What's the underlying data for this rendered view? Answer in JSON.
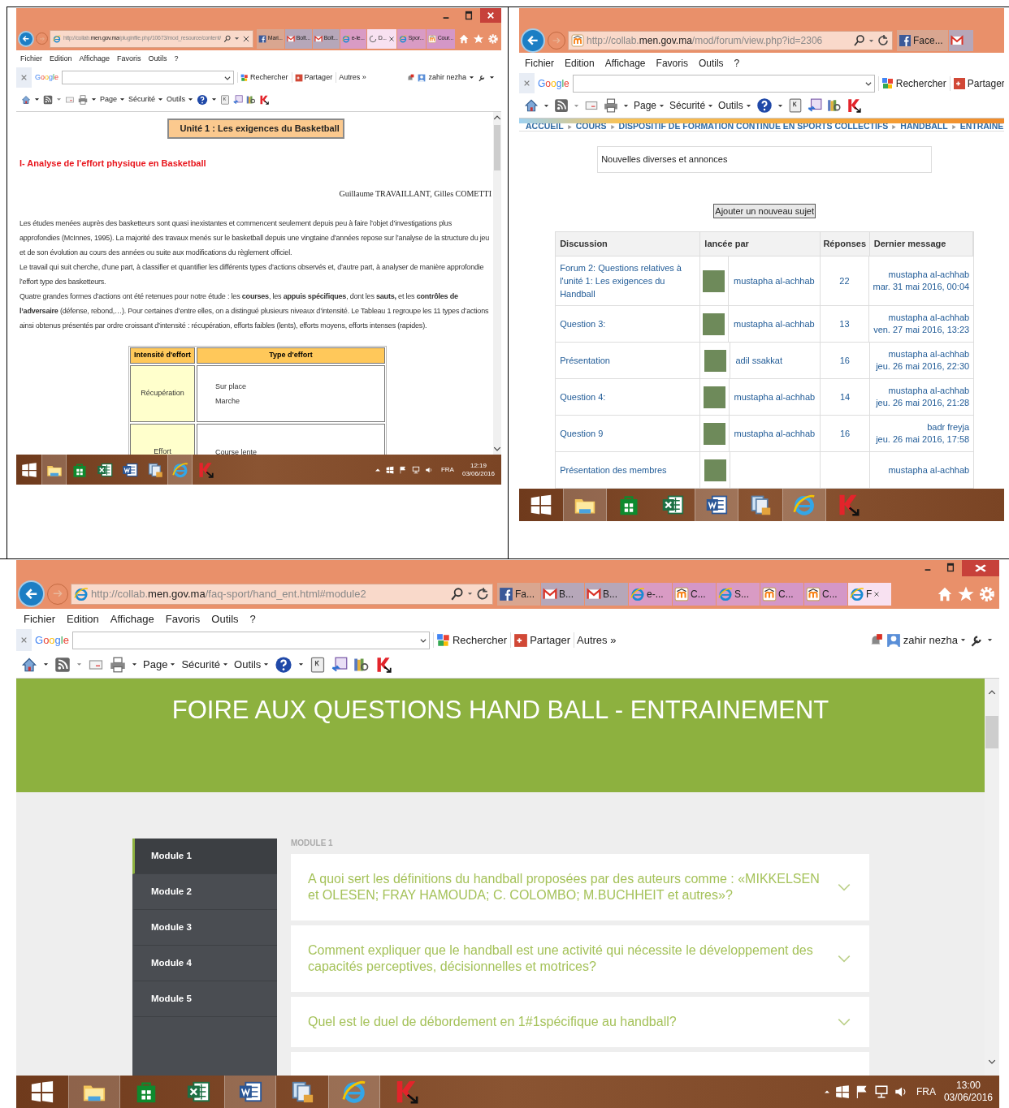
{
  "windows": [
    {
      "window_controls": true,
      "address": {
        "parts": [
          "http://collab.",
          "men.gov.ma",
          "/pluginfile.php/10673/mod_resource/content/"
        ]
      },
      "tabs": [
        {
          "label": "Mari...",
          "kind": "facebook",
          "selected": false
        },
        {
          "label": "Boît...",
          "kind": "mail",
          "selected": false
        },
        {
          "label": "Boît...",
          "kind": "mail",
          "selected": false
        },
        {
          "label": "e-le...",
          "kind": "browser",
          "selected": false
        },
        {
          "label": "D...",
          "kind": "loading",
          "selected": true
        },
        {
          "label": "Spor...",
          "kind": "browser",
          "selected": false
        },
        {
          "label": "Cour...",
          "kind": "course",
          "selected": false
        }
      ],
      "nav_icons": true,
      "menu": [
        "Fichier",
        "Edition",
        "Affichage",
        "Favoris",
        "Outils",
        "?"
      ],
      "google_toolbar": {
        "logo": "Google",
        "buttons": [
          {
            "label": "Rechercher",
            "kind": "search"
          },
          {
            "label": "Partager",
            "kind": "share"
          },
          {
            "label": "Autres »",
            "kind": "plain"
          }
        ],
        "user": "zahir nezha"
      },
      "command_bar": [
        "Page",
        "Sécurité",
        "Outils"
      ],
      "content": {
        "kind": "document",
        "title": "Unité 1 : Les exigences du Basketball",
        "heading": "I- Analyse de l'effort physique en Basketball",
        "authors": "Guillaume TRAVAILLANT, Gilles COMETTI",
        "paragraphs": [
          "Les études menées auprès des basketteurs sont quasi inexistantes et commencent seulement depuis peu à faire l’objet d’investigations plus approfondies (McInnes, 1995). La majorité des travaux menés sur le basketball depuis une vingtaine d’années repose sur l’analyse de la structure du jeu et de son évolution au cours des années ou suite aux modifications du règlement officiel.",
          "Le travail qui suit cherche, d’une part, à classifier et quantifier les différents types d’actions observés et, d’autre part, à analyser de manière approfondie l’effort type des basketteurs.",
          "Quatre grandes formes d’actions ont été retenues pour notre étude : les **courses**, les **appuis spécifiques**, dont les **sauts,** et les **contrôles de l’adversaire** (défense, rebond,…). Pour certaines d’entre elles, on a distingué plusieurs niveaux d’intensité. Le Tableau 1 regroupe les 11 types d’actions ainsi obtenus présentés par ordre croissant d’intensité : récupération, efforts faibles (lents), efforts moyens, efforts intenses (rapides)."
        ],
        "table": {
          "columns": [
            "Intensité d'effort",
            "Type d'effort"
          ],
          "rows": [
            {
              "intensity": "Récupération",
              "types": [
                "Sur place",
                "Marche"
              ]
            },
            {
              "intensity": "Effort",
              "types": [
                "Course lente"
              ]
            }
          ]
        }
      },
      "taskbar": {
        "items": [
          {
            "kind": "start",
            "running": false
          },
          {
            "kind": "explorer",
            "running": true
          },
          {
            "kind": "store",
            "running": false
          },
          {
            "kind": "spreadsheet",
            "running": false
          },
          {
            "kind": "document",
            "running": false
          },
          {
            "kind": "files",
            "running": false
          },
          {
            "kind": "browser",
            "running": true
          },
          {
            "kind": "antivirus",
            "running": false
          }
        ],
        "tray": {
          "language": "FRA",
          "time": "12:19",
          "date": "03/06/2016"
        }
      }
    },
    {
      "window_controls": false,
      "address": {
        "parts": [
          "http://collab.",
          "men.gov.ma",
          "/mod/forum/view.php?id=2306"
        ]
      },
      "tabs": [
        {
          "label": "Face...",
          "kind": "facebook",
          "selected": false
        },
        {
          "kind": "mail",
          "selected": false
        }
      ],
      "nav_icons": false,
      "menu": [
        "Fichier",
        "Edition",
        "Affichage",
        "Favoris",
        "Outils",
        "?"
      ],
      "google_toolbar": {
        "logo": "Google",
        "buttons": [
          {
            "label": "Rechercher",
            "kind": "search"
          },
          {
            "label": "Partager",
            "kind": "share"
          }
        ]
      },
      "command_bar": [
        "Page",
        "Sécurité",
        "Outils"
      ],
      "content": {
        "kind": "forum",
        "breadcrumb": [
          "ACCUEIL",
          "COURS",
          "DISPOSITIF DE FORMATION CONTINUE EN SPORTS COLLECTIFS",
          "HANDBALL",
          "ENTRAINE"
        ],
        "intro": "Nouvelles diverses et annonces",
        "add_button": "Ajouter un nouveau sujet",
        "columns": [
          "Discussion",
          "lancée par",
          "Réponses",
          "Dernier message"
        ],
        "rows": [
          {
            "discussion": "Forum 2: Questions relatives à l'unité 1: Les exigences du Handball",
            "author": "mustapha al-achhab",
            "replies": "22",
            "last_author": "mustapha al-achhab",
            "last_date": "mar. 31 mai 2016, 00:04"
          },
          {
            "discussion": "Question 3:",
            "author": "mustapha al-achhab",
            "replies": "13",
            "last_author": "mustapha al-achhab",
            "last_date": "ven. 27 mai 2016, 13:23"
          },
          {
            "discussion": "Présentation",
            "author": "adil ssakkat",
            "replies": "16",
            "last_author": "mustapha al-achhab",
            "last_date": "jeu. 26 mai 2016, 22:30"
          },
          {
            "discussion": "Question 4:",
            "author": "mustapha al-achhab",
            "replies": "14",
            "last_author": "mustapha al-achhab",
            "last_date": "jeu. 26 mai 2016, 21:28"
          },
          {
            "discussion": "Question 9",
            "author": "mustapha al-achhab",
            "replies": "16",
            "last_author": "badr freyja",
            "last_date": "jeu. 26 mai 2016, 17:58"
          },
          {
            "discussion": "Présentation des membres",
            "last_author": "mustapha al-achhab"
          }
        ]
      },
      "taskbar": {
        "items": [
          {
            "kind": "start",
            "running": false
          },
          {
            "kind": "explorer",
            "running": true
          },
          {
            "kind": "store",
            "running": false
          },
          {
            "kind": "spreadsheet",
            "running": false
          },
          {
            "kind": "document",
            "running": true
          },
          {
            "kind": "files",
            "running": false
          },
          {
            "kind": "browser",
            "running": true
          },
          {
            "kind": "antivirus",
            "running": false
          }
        ]
      }
    },
    {
      "window_controls": true,
      "address": {
        "parts": [
          "http://collab.",
          "men.gov.ma",
          "/faq-sport/hand_ent.html#module2"
        ]
      },
      "tabs": [
        {
          "label": "Fa...",
          "kind": "facebook",
          "selected": false
        },
        {
          "label": "B...",
          "kind": "mail",
          "selected": false
        },
        {
          "label": "B...",
          "kind": "mail",
          "selected": false
        },
        {
          "label": "e-...",
          "kind": "browser",
          "selected": false
        },
        {
          "label": "C...",
          "kind": "course",
          "selected": false
        },
        {
          "label": "S...",
          "kind": "browser",
          "selected": false
        },
        {
          "label": "C...",
          "kind": "course",
          "selected": false
        },
        {
          "label": "C...",
          "kind": "course",
          "selected": false
        },
        {
          "label": "F",
          "kind": "browser",
          "selected": true
        }
      ],
      "nav_icons": true,
      "menu": [
        "Fichier",
        "Edition",
        "Affichage",
        "Favoris",
        "Outils",
        "?"
      ],
      "google_toolbar": {
        "logo": "Google",
        "buttons": [
          {
            "label": "Rechercher",
            "kind": "search"
          },
          {
            "label": "Partager",
            "kind": "share"
          },
          {
            "label": "Autres »",
            "kind": "plain"
          }
        ],
        "user": "zahir nezha"
      },
      "command_bar": [
        "Page",
        "Sécurité",
        "Outils"
      ],
      "content": {
        "kind": "faq",
        "title": "FOIRE AUX QUESTIONS HAND BALL - ENTRAINEMENT",
        "modules": [
          {
            "label": "Module 1",
            "selected": true
          },
          {
            "label": "Module 2",
            "selected": false
          },
          {
            "label": "Module 3",
            "selected": false
          },
          {
            "label": "Module 4",
            "selected": false
          },
          {
            "label": "Module 5",
            "selected": false
          }
        ],
        "section_label": "MODULE 1",
        "questions": [
          "A quoi sert les définitions du handball proposées par des auteurs comme : «MIKKELSEN et OLESEN; FRAY HAMOUDA; C. COLOMBO; M.BUCHHEIT et autres»?",
          "Comment expliquer que le handball est une activité qui nécessite le développement des capacités perceptives, décisionnelles et motrices?",
          "Quel est le duel de débordement en 1#1spécifique au handball?"
        ]
      },
      "taskbar": {
        "items": [
          {
            "kind": "start",
            "running": false
          },
          {
            "kind": "explorer",
            "running": true
          },
          {
            "kind": "store",
            "running": false
          },
          {
            "kind": "spreadsheet",
            "running": false
          },
          {
            "kind": "document",
            "running": true
          },
          {
            "kind": "files",
            "running": false
          },
          {
            "kind": "browser",
            "running": true
          },
          {
            "kind": "antivirus",
            "running": false
          }
        ],
        "tray": {
          "language": "FRA",
          "time": "13:00",
          "date": "03/06/2016"
        }
      }
    }
  ]
}
